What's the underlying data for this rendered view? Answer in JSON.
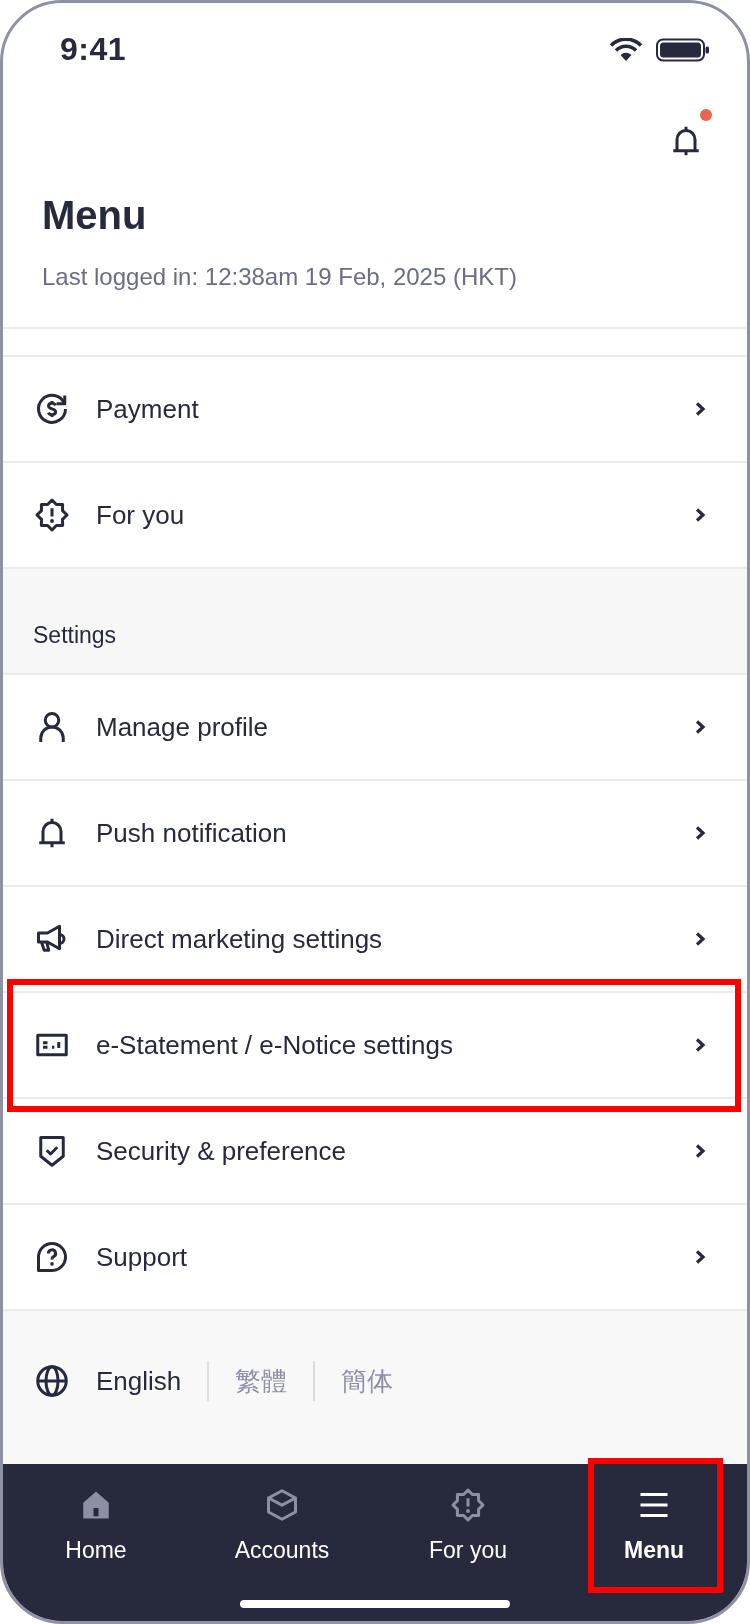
{
  "status_bar": {
    "time": "9:41"
  },
  "header": {
    "has_unread": true,
    "title": "Menu",
    "last_login": "Last logged in: 12:38am 19 Feb, 2025 (HKT)"
  },
  "menu": [
    {
      "kind": "item",
      "label": "Payment",
      "highlighted": false
    },
    {
      "kind": "item",
      "label": "For you",
      "highlighted": false
    },
    {
      "kind": "section",
      "label": "Settings",
      "highlighted": false
    },
    {
      "kind": "item",
      "label": "Manage profile",
      "highlighted": false
    },
    {
      "kind": "item",
      "label": "Push notification",
      "highlighted": false
    },
    {
      "kind": "item",
      "label": "Direct marketing settings",
      "highlighted": false
    },
    {
      "kind": "item",
      "label": "e-Statement / e-Notice settings",
      "highlighted": true
    },
    {
      "kind": "item",
      "label": "Security & preference",
      "highlighted": false
    },
    {
      "kind": "item",
      "label": "Support",
      "highlighted": false
    }
  ],
  "languages": [
    {
      "label": "English",
      "selected": true
    },
    {
      "label": "繁體",
      "selected": false
    },
    {
      "label": "簡体",
      "selected": false
    }
  ],
  "bottom_nav": [
    {
      "label": "Home",
      "selected": false,
      "highlighted": false
    },
    {
      "label": "Accounts",
      "selected": false,
      "highlighted": false
    },
    {
      "label": "For you",
      "selected": false,
      "highlighted": false
    },
    {
      "label": "Menu",
      "selected": true,
      "highlighted": true
    }
  ]
}
